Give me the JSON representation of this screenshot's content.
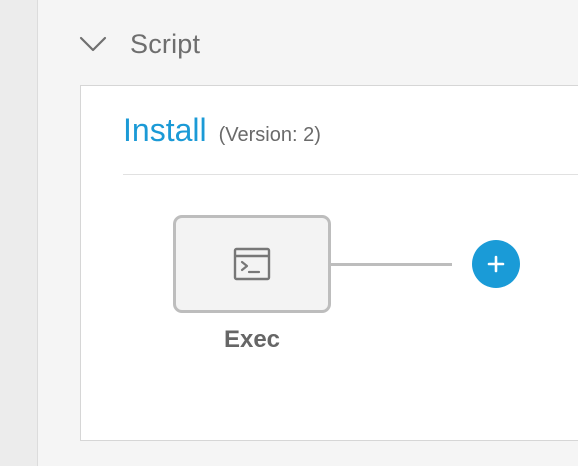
{
  "section": {
    "title": "Script",
    "chevron_icon": "chevron-down-icon"
  },
  "panel": {
    "title": "Install",
    "version_label": "(Version: 2)",
    "step": {
      "label": "Exec",
      "icon": "terminal-icon"
    },
    "add_step_icon": "plus-icon"
  },
  "colors": {
    "accent": "#1b9ad6",
    "text_muted": "#6e6e6e",
    "node_border": "#bdbdbd",
    "panel_border": "#d6d6d6",
    "background": "#f5f5f5"
  }
}
